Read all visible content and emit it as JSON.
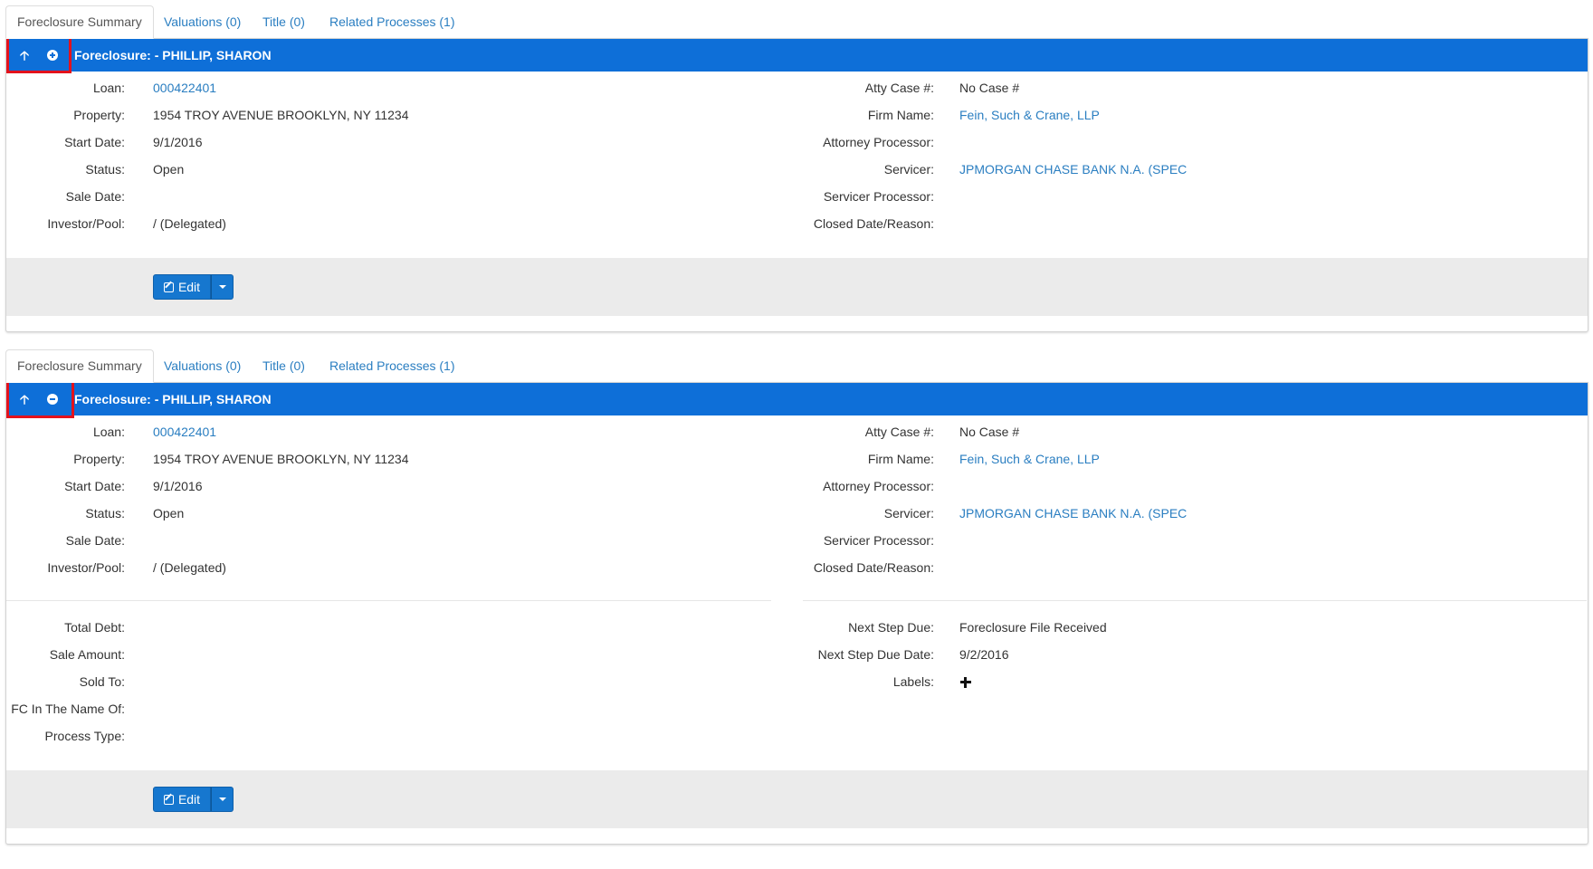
{
  "tabs": [
    {
      "label": "Foreclosure Summary"
    },
    {
      "label": "Valuations (0)"
    },
    {
      "label": "Title (0)"
    },
    {
      "label": "Related Processes (1)"
    }
  ],
  "header": {
    "title": "Foreclosure: - PHILLIP, SHARON",
    "icons": {
      "up": "arrow-up-icon",
      "expand": "plus-circle-icon",
      "collapse": "minus-circle-icon"
    }
  },
  "summary": {
    "left": [
      {
        "label": "Loan:",
        "value": "000422401",
        "link": true
      },
      {
        "label": "Property:",
        "value": "1954 TROY AVENUE BROOKLYN, NY 11234",
        "link": false
      },
      {
        "label": "Start Date:",
        "value": "9/1/2016",
        "link": false
      },
      {
        "label": "Status:",
        "value": "Open",
        "link": false
      },
      {
        "label": "Sale Date:",
        "value": "",
        "link": false
      },
      {
        "label": "Investor/Pool:",
        "value": "/ (Delegated)",
        "link": false
      }
    ],
    "right": [
      {
        "label": "Atty Case #:",
        "value": "No Case #",
        "link": false
      },
      {
        "label": "Firm Name:",
        "value": "Fein, Such & Crane, LLP",
        "link": true
      },
      {
        "label": "Attorney Processor:",
        "value": "",
        "link": false
      },
      {
        "label": "Servicer:",
        "value": "JPMORGAN CHASE BANK N.A. (SPEC",
        "link": true
      },
      {
        "label": "Servicer Processor:",
        "value": "",
        "link": false
      },
      {
        "label": "Closed Date/Reason:",
        "value": "",
        "link": false
      }
    ]
  },
  "details": {
    "left": [
      {
        "label": "Total Debt:",
        "value": ""
      },
      {
        "label": "Sale Amount:",
        "value": ""
      },
      {
        "label": "Sold To:",
        "value": ""
      },
      {
        "label": "FC In The Name Of:",
        "value": ""
      },
      {
        "label": "Process Type:",
        "value": ""
      }
    ],
    "right": [
      {
        "label": "Next Step Due:",
        "value": "Foreclosure File Received"
      },
      {
        "label": "Next Step Due Date:",
        "value": "9/2/2016"
      },
      {
        "label": "Labels:",
        "value": ""
      }
    ]
  },
  "buttons": {
    "edit_label": "Edit",
    "caret_icon": "caret-down-icon",
    "edit_icon": "edit-icon",
    "labels_add_icon": "plus-icon"
  },
  "colors": {
    "header_bg": "#0e6fd8",
    "highlight": "#e3121c",
    "link": "#2a7ec1",
    "footer_bg": "#ebebeb"
  }
}
